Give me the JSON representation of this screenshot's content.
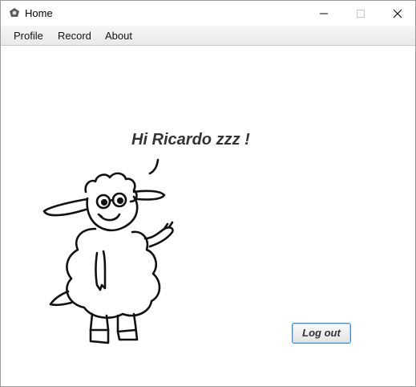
{
  "window": {
    "title": "Home"
  },
  "menu": {
    "items": [
      "Profile",
      "Record",
      "About"
    ]
  },
  "main": {
    "greeting": "Hi Ricardo zzz !",
    "illustration": "waving-sheep-icon"
  },
  "actions": {
    "logout_label": "Log out"
  },
  "colors": {
    "accent": "#3a8fd8",
    "text": "#333333",
    "menubar": "#efefef"
  }
}
